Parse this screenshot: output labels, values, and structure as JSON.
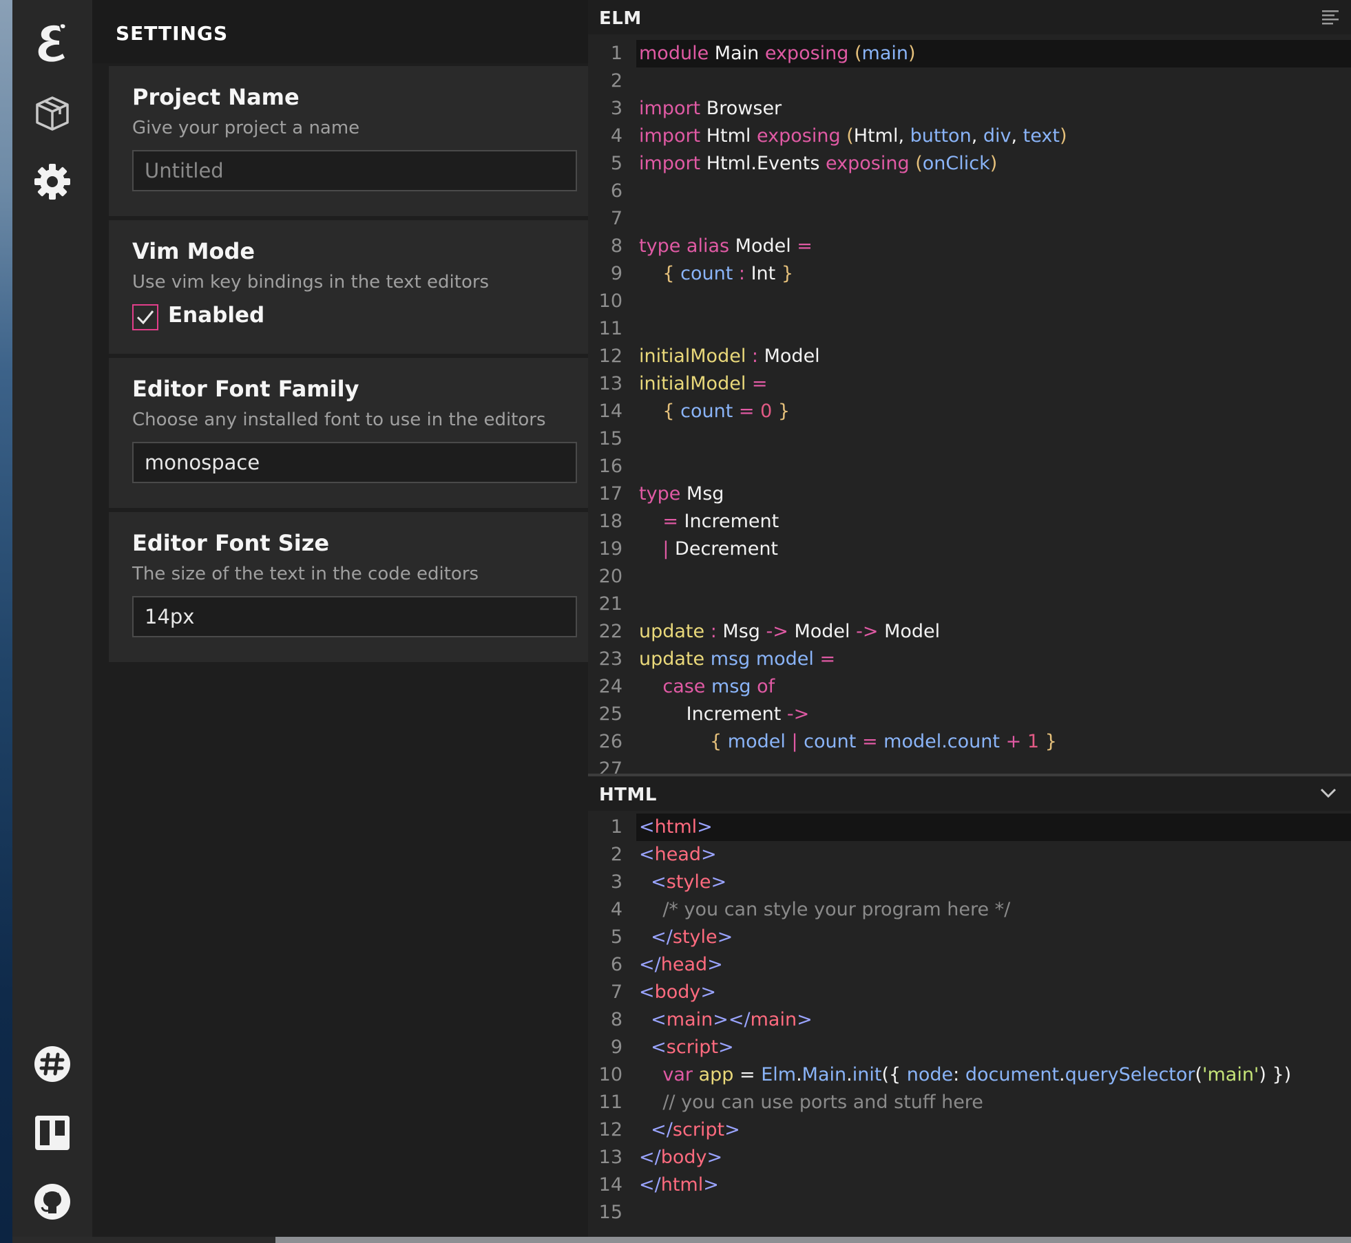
{
  "settings": {
    "title": "SETTINGS",
    "project_name": {
      "title": "Project Name",
      "description": "Give your project a name",
      "placeholder": "Untitled",
      "value": ""
    },
    "vim_mode": {
      "title": "Vim Mode",
      "description": "Use vim key bindings in the text editors",
      "checkbox_label": "Enabled",
      "checked": true
    },
    "font_family": {
      "title": "Editor Font Family",
      "description": "Choose any installed font to use in the editors",
      "value": "monospace"
    },
    "font_size": {
      "title": "Editor Font Size",
      "description": "The size of the text in the code editors",
      "value": "14px"
    }
  },
  "rail": {
    "top_icons": [
      "ellie-logo-icon",
      "package-icon",
      "gear-icon"
    ],
    "bottom_icons": [
      "slack-icon",
      "trello-icon",
      "github-icon"
    ]
  },
  "elm_pane": {
    "title": "ELM",
    "menu_icon": "align-icon",
    "lines": [
      [
        [
          "kw",
          "module"
        ],
        [
          "ty",
          " Main "
        ],
        [
          "kw",
          "exposing"
        ],
        [
          "ty",
          " "
        ],
        [
          "pu",
          "("
        ],
        [
          "va",
          "main"
        ],
        [
          "pu",
          ")"
        ]
      ],
      [],
      [
        [
          "kw",
          "import"
        ],
        [
          "ty",
          " Browser"
        ]
      ],
      [
        [
          "kw",
          "import"
        ],
        [
          "ty",
          " Html "
        ],
        [
          "kw",
          "exposing"
        ],
        [
          "ty",
          " "
        ],
        [
          "pu",
          "("
        ],
        [
          "ty",
          "Html"
        ],
        [
          "ty",
          ", "
        ],
        [
          "va",
          "button"
        ],
        [
          "ty",
          ", "
        ],
        [
          "va",
          "div"
        ],
        [
          "ty",
          ", "
        ],
        [
          "va",
          "text"
        ],
        [
          "pu",
          ")"
        ]
      ],
      [
        [
          "kw",
          "import"
        ],
        [
          "ty",
          " Html.Events "
        ],
        [
          "kw",
          "exposing"
        ],
        [
          "ty",
          " "
        ],
        [
          "pu",
          "("
        ],
        [
          "va",
          "onClick"
        ],
        [
          "pu",
          ")"
        ]
      ],
      [],
      [],
      [
        [
          "kw",
          "type alias"
        ],
        [
          "ty",
          " Model "
        ],
        [
          "op",
          "="
        ]
      ],
      [
        [
          "ty",
          "    "
        ],
        [
          "pu",
          "{"
        ],
        [
          "ty",
          " "
        ],
        [
          "va",
          "count"
        ],
        [
          "ty",
          " "
        ],
        [
          "op",
          ":"
        ],
        [
          "ty",
          " Int "
        ],
        [
          "pu",
          "}"
        ]
      ],
      [],
      [],
      [
        [
          "fn",
          "initialModel"
        ],
        [
          "ty",
          " "
        ],
        [
          "op",
          ":"
        ],
        [
          "ty",
          " Model"
        ]
      ],
      [
        [
          "fn",
          "initialModel"
        ],
        [
          "ty",
          " "
        ],
        [
          "op",
          "="
        ]
      ],
      [
        [
          "ty",
          "    "
        ],
        [
          "pu",
          "{"
        ],
        [
          "ty",
          " "
        ],
        [
          "va",
          "count"
        ],
        [
          "ty",
          " "
        ],
        [
          "op",
          "="
        ],
        [
          "ty",
          " "
        ],
        [
          "nu",
          "0"
        ],
        [
          "ty",
          " "
        ],
        [
          "pu",
          "}"
        ]
      ],
      [],
      [],
      [
        [
          "kw",
          "type"
        ],
        [
          "ty",
          " Msg"
        ]
      ],
      [
        [
          "ty",
          "    "
        ],
        [
          "op",
          "="
        ],
        [
          "ty",
          " Increment"
        ]
      ],
      [
        [
          "ty",
          "    "
        ],
        [
          "op",
          "|"
        ],
        [
          "ty",
          " Decrement"
        ]
      ],
      [],
      [],
      [
        [
          "fn",
          "update"
        ],
        [
          "ty",
          " "
        ],
        [
          "op",
          ":"
        ],
        [
          "ty",
          " Msg "
        ],
        [
          "op",
          "->"
        ],
        [
          "ty",
          " Model "
        ],
        [
          "op",
          "->"
        ],
        [
          "ty",
          " Model"
        ]
      ],
      [
        [
          "fn",
          "update"
        ],
        [
          "ty",
          " "
        ],
        [
          "va",
          "msg model"
        ],
        [
          "ty",
          " "
        ],
        [
          "op",
          "="
        ]
      ],
      [
        [
          "ty",
          "    "
        ],
        [
          "kw",
          "case"
        ],
        [
          "ty",
          " "
        ],
        [
          "va",
          "msg"
        ],
        [
          "ty",
          " "
        ],
        [
          "kw",
          "of"
        ]
      ],
      [
        [
          "ty",
          "        Increment "
        ],
        [
          "op",
          "->"
        ]
      ],
      [
        [
          "ty",
          "            "
        ],
        [
          "pu",
          "{"
        ],
        [
          "ty",
          " "
        ],
        [
          "va",
          "model"
        ],
        [
          "ty",
          " "
        ],
        [
          "op",
          "|"
        ],
        [
          "ty",
          " "
        ],
        [
          "va",
          "count"
        ],
        [
          "ty",
          " "
        ],
        [
          "op",
          "="
        ],
        [
          "ty",
          " "
        ],
        [
          "va",
          "model.count"
        ],
        [
          "ty",
          " "
        ],
        [
          "op",
          "+"
        ],
        [
          "ty",
          " "
        ],
        [
          "nu",
          "1"
        ],
        [
          "ty",
          " "
        ],
        [
          "pu",
          "}"
        ]
      ],
      []
    ]
  },
  "html_pane": {
    "title": "HTML",
    "collapse_icon": "chevron-down-icon",
    "lines": [
      [
        [
          "br",
          "<"
        ],
        [
          "tg",
          "html"
        ],
        [
          "br",
          ">"
        ]
      ],
      [
        [
          "br",
          "<"
        ],
        [
          "tg",
          "head"
        ],
        [
          "br",
          ">"
        ]
      ],
      [
        [
          "ty",
          "  "
        ],
        [
          "br",
          "<"
        ],
        [
          "tg",
          "style"
        ],
        [
          "br",
          ">"
        ]
      ],
      [
        [
          "cm",
          "    /* you can style your program here */"
        ]
      ],
      [
        [
          "ty",
          "  "
        ],
        [
          "br",
          "</"
        ],
        [
          "tg",
          "style"
        ],
        [
          "br",
          ">"
        ]
      ],
      [
        [
          "br",
          "</"
        ],
        [
          "tg",
          "head"
        ],
        [
          "br",
          ">"
        ]
      ],
      [
        [
          "br",
          "<"
        ],
        [
          "tg",
          "body"
        ],
        [
          "br",
          ">"
        ]
      ],
      [
        [
          "ty",
          "  "
        ],
        [
          "br",
          "<"
        ],
        [
          "tg",
          "main"
        ],
        [
          "br",
          "></"
        ],
        [
          "tg",
          "main"
        ],
        [
          "br",
          ">"
        ]
      ],
      [
        [
          "ty",
          "  "
        ],
        [
          "br",
          "<"
        ],
        [
          "tg",
          "script"
        ],
        [
          "br",
          ">"
        ]
      ],
      [
        [
          "ty",
          "    "
        ],
        [
          "kw",
          "var"
        ],
        [
          "ty",
          " "
        ],
        [
          "fn",
          "app"
        ],
        [
          "ty",
          " "
        ],
        [
          "ty",
          "="
        ],
        [
          "ty",
          " "
        ],
        [
          "va",
          "Elm"
        ],
        [
          "ty",
          "."
        ],
        [
          "va",
          "Main"
        ],
        [
          "ty",
          "."
        ],
        [
          "va",
          "init"
        ],
        [
          "ty",
          "({ "
        ],
        [
          "va",
          "node"
        ],
        [
          "ty",
          ": "
        ],
        [
          "va",
          "document"
        ],
        [
          "ty",
          "."
        ],
        [
          "va",
          "querySelector"
        ],
        [
          "ty",
          "("
        ],
        [
          "st",
          "'main'"
        ],
        [
          "ty",
          ") })"
        ]
      ],
      [
        [
          "cm",
          "    // you can use ports and stuff here"
        ]
      ],
      [
        [
          "ty",
          "  "
        ],
        [
          "br",
          "</"
        ],
        [
          "tg",
          "script"
        ],
        [
          "br",
          ">"
        ]
      ],
      [
        [
          "br",
          "</"
        ],
        [
          "tg",
          "body"
        ],
        [
          "br",
          ">"
        ]
      ],
      [
        [
          "br",
          "</"
        ],
        [
          "tg",
          "html"
        ],
        [
          "br",
          ">"
        ]
      ],
      []
    ]
  }
}
